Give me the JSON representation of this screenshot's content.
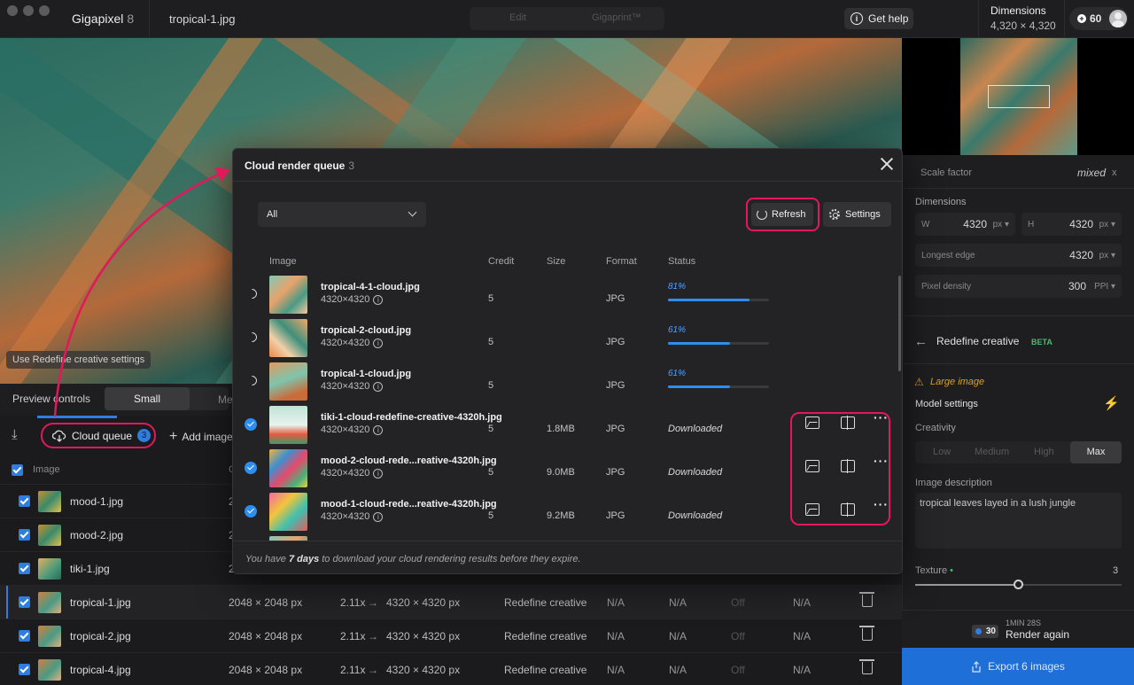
{
  "titlebar": {
    "app_name": "Gigapixel",
    "app_version": "8",
    "file_name": "tropical-1.jpg",
    "mode_tabs": [
      "Edit",
      "Gigaprint™"
    ],
    "help_label": "Get help",
    "dimensions_label": "Dimensions",
    "dimensions_value": "4,320 × 4,320",
    "credits": "60"
  },
  "preview": {
    "hint": "Use Redefine creative settings",
    "controls_label": "Preview controls",
    "size_options": [
      "Small",
      "Me"
    ]
  },
  "queue_bar": {
    "cloud_queue_label": "Cloud queue",
    "cloud_queue_count": "3",
    "add_image_label": "Add image"
  },
  "list": {
    "header_image": "Image",
    "header_c": "C",
    "rows": [
      {
        "name": "mood-1.jpg",
        "c": "2",
        "active": false
      },
      {
        "name": "mood-2.jpg",
        "c": "2",
        "active": false
      },
      {
        "name": "tiki-1.jpg",
        "c": "2",
        "active": false
      },
      {
        "name": "tropical-1.jpg",
        "size": "2048 × 2048 px",
        "scale": "2.11x",
        "arrow": "→",
        "output": "4320 × 4320 px",
        "model": "Redefine creative",
        "na1": "N/A",
        "na2": "N/A",
        "off": "Off",
        "na3": "N/A",
        "active": true
      },
      {
        "name": "tropical-2.jpg",
        "size": "2048 × 2048 px",
        "scale": "2.11x",
        "arrow": "→",
        "output": "4320 × 4320 px",
        "model": "Redefine creative",
        "na1": "N/A",
        "na2": "N/A",
        "off": "Off",
        "na3": "N/A",
        "active": false
      },
      {
        "name": "tropical-4.jpg",
        "size": "2048 × 2048 px",
        "scale": "2.11x",
        "arrow": "→",
        "output": "4320 × 4320 px",
        "model": "Redefine creative",
        "na1": "N/A",
        "na2": "N/A",
        "off": "Off",
        "na3": "N/A",
        "active": false
      }
    ]
  },
  "right_panel": {
    "scale_factor_label": "Scale factor",
    "scale_factor_value": "mixed",
    "scale_factor_x": "x",
    "dimensions_label": "Dimensions",
    "w_label": "W",
    "w_value": "4320",
    "w_unit": "px",
    "h_label": "H",
    "h_value": "4320",
    "h_unit": "px",
    "longest_edge_label": "Longest edge",
    "longest_edge_value": "4320",
    "longest_edge_unit": "px",
    "pixel_density_label": "Pixel density",
    "pixel_density_value": "300",
    "pixel_density_unit": "PPI",
    "model_title": "Redefine creative",
    "model_badge": "BETA",
    "warning": "Large image",
    "model_settings_label": "Model settings",
    "creativity_label": "Creativity",
    "creativity_options": [
      "Low",
      "Medium",
      "High",
      "Max"
    ],
    "creativity_selected": "Max",
    "image_description_label": "Image description",
    "image_description_value": "tropical leaves layed in a lush jungle",
    "texture_label": "Texture",
    "texture_value": "3",
    "texture_level": 0.5,
    "render_time": "1MIN 28S",
    "render_credits": "30",
    "render_again_label": "Render again",
    "export_label": "Export 6 images"
  },
  "modal": {
    "title": "Cloud render queue",
    "count": "3",
    "filter_value": "All",
    "refresh_label": "Refresh",
    "settings_label": "Settings",
    "columns": {
      "image": "Image",
      "credit": "Credit",
      "size": "Size",
      "format": "Format",
      "status": "Status"
    },
    "rows": [
      {
        "name": "tropical-4-1-cloud.jpg",
        "dims": "4320×4320",
        "credit": "5",
        "size": "",
        "format": "JPG",
        "state": "processing",
        "progress_text": "81%",
        "progress": 0.81
      },
      {
        "name": "tropical-2-cloud.jpg",
        "dims": "4320×4320",
        "credit": "5",
        "size": "",
        "format": "JPG",
        "state": "processing",
        "progress_text": "61%",
        "progress": 0.61
      },
      {
        "name": "tropical-1-cloud.jpg",
        "dims": "4320×4320",
        "credit": "5",
        "size": "",
        "format": "JPG",
        "state": "processing",
        "progress_text": "61%",
        "progress": 0.61
      },
      {
        "name": "tiki-1-cloud-redefine-creative-4320h.jpg",
        "dims": "4320×4320",
        "credit": "5",
        "size": "1.8MB",
        "format": "JPG",
        "state": "done",
        "status": "Downloaded"
      },
      {
        "name": "mood-2-cloud-rede...reative-4320h.jpg",
        "dims": "4320×4320",
        "credit": "5",
        "size": "9.0MB",
        "format": "JPG",
        "state": "done",
        "status": "Downloaded"
      },
      {
        "name": "mood-1-cloud-rede...reative-4320h.jpg",
        "dims": "4320×4320",
        "credit": "5",
        "size": "9.2MB",
        "format": "JPG",
        "state": "done",
        "status": "Downloaded"
      }
    ],
    "footer_prefix": "You have ",
    "footer_days": "7 days",
    "footer_suffix": " to download your cloud rendering results before they expire."
  },
  "colors": {
    "accent": "#2e7de0",
    "highlight": "#e3175b",
    "export": "#1f6fd9",
    "beta": "#39c46a",
    "warning": "#e0a020"
  }
}
